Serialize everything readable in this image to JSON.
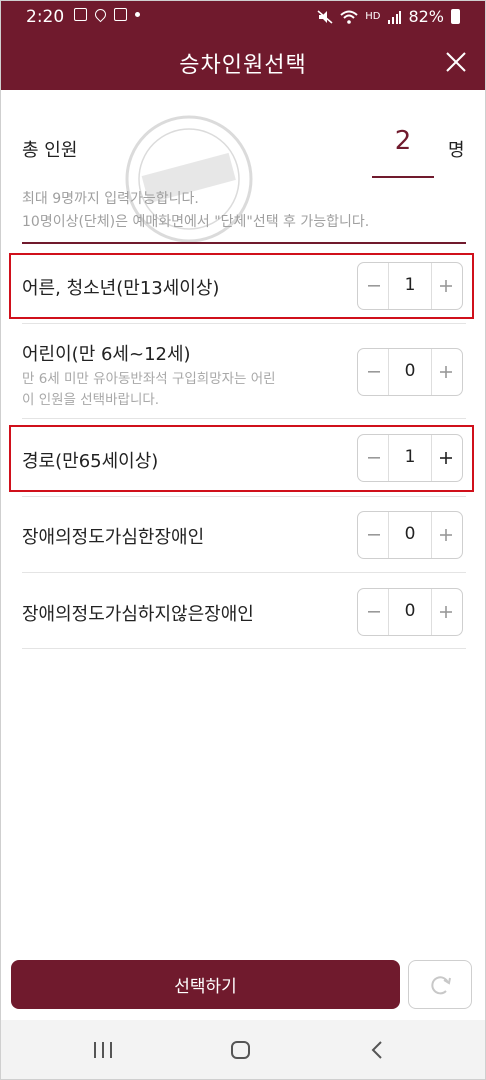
{
  "status_bar": {
    "time": "2:20",
    "battery": "82%",
    "signal_text": "HD"
  },
  "header": {
    "title": "승차인원선택"
  },
  "total": {
    "label": "총 인원",
    "count": "2",
    "unit": "명"
  },
  "notice": [
    "최대 9명까지 입력가능합니다.",
    "10명이상(단체)은 예매화면에서 \"단체\"선택 후 가능합니다."
  ],
  "passengers": [
    {
      "label": "어른, 청소년(만13세이상)",
      "value": "1",
      "sub": []
    },
    {
      "label": "어린이(만 6세~12세)",
      "value": "0",
      "sub": [
        "만 6세 미만 유아동반좌석 구입희망자는 어린",
        "이 인원을 선택바랍니다."
      ]
    },
    {
      "label": "경로(만65세이상)",
      "value": "1",
      "sub": []
    },
    {
      "label": "장애의정도가심한장애인",
      "value": "0",
      "sub": []
    },
    {
      "label": "장애의정도가심하지않은장애인",
      "value": "0",
      "sub": []
    }
  ],
  "footer": {
    "select_label": "선택하기"
  },
  "colors": {
    "brand": "#701a2d",
    "highlight": "#d0101b"
  },
  "icons": [
    "close-icon",
    "minus-icon",
    "plus-icon",
    "refresh-icon",
    "recent-apps-icon",
    "home-icon",
    "back-icon"
  ]
}
